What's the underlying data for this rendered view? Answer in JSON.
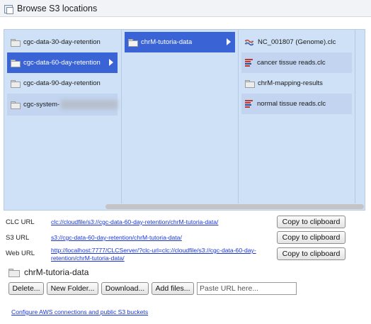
{
  "window": {
    "title": "Browse S3 locations"
  },
  "browser": {
    "column1": [
      {
        "label": "cgc-data-30-day-retention",
        "selected": false
      },
      {
        "label": "cgc-data-60-day-retention",
        "selected": true
      },
      {
        "label": "cgc-data-90-day-retention",
        "selected": false
      },
      {
        "label": "cgc-system-",
        "selected": false
      }
    ],
    "column2": [
      {
        "label": "chrM-tutoria-data",
        "selected": true
      }
    ],
    "column3": [
      {
        "label": "NC_001807 (Genome).clc",
        "icon": "genome-icon"
      },
      {
        "label": "cancer tissue reads.clc",
        "icon": "reads-icon"
      },
      {
        "label": "chrM-mapping-results",
        "icon": "folder-icon"
      },
      {
        "label": "normal tissue reads.clc",
        "icon": "reads-icon"
      }
    ]
  },
  "urls": {
    "clc": {
      "label": "CLC URL",
      "value": "clc://cloudfile/s3://cgc-data-60-day-retention/chrM-tutoria-data/",
      "button": "Copy to clipboard"
    },
    "s3": {
      "label": "S3 URL",
      "value": "s3://cgc-data-60-day-retention/chrM-tutoria-data/",
      "button": "Copy to clipboard"
    },
    "web": {
      "label": "Web URL",
      "value": "http://localhost:7777/CLCServer/?clc-url=clc://cloudfile/s3://cgc-data-60-day-retention/chrM-tutoria-data/",
      "button": "Copy to clipboard"
    }
  },
  "current_path": "chrM-tutoria-data",
  "actions": {
    "delete": "Delete...",
    "new_folder": "New Folder...",
    "download": "Download...",
    "add_files": "Add files...",
    "paste_placeholder": "Paste URL here..."
  },
  "footer": {
    "config_link": "Configure AWS connections and public S3 buckets"
  }
}
